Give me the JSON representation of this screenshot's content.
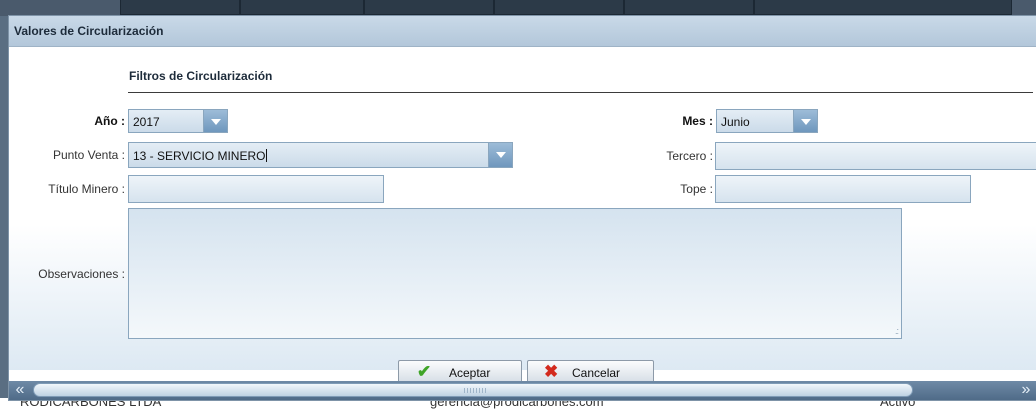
{
  "window": {
    "title": "Valores de Circularización"
  },
  "section": {
    "title": "Filtros de Circularización"
  },
  "form": {
    "anio": {
      "label": "Año :",
      "value": "2017"
    },
    "mes": {
      "label": "Mes :",
      "value": "Junio"
    },
    "punto_venta": {
      "label": "Punto Venta :",
      "value": "13 - SERVICIO MINERO"
    },
    "tercero": {
      "label": "Tercero :",
      "value": ""
    },
    "titulo_minero": {
      "label": "Título Minero :",
      "value": ""
    },
    "tope": {
      "label": "Tope :",
      "value": ""
    },
    "observaciones": {
      "label": "Observaciones :",
      "value": ""
    }
  },
  "buttons": {
    "aceptar": "Aceptar",
    "cancelar": "Cancelar"
  },
  "background_row": {
    "company": "RODICARBONES LTDA",
    "email": "gerencia@prodicarbones.com",
    "status": "Activo"
  },
  "colors": {
    "accept_icon": "#3fa427",
    "cancel_icon": "#d32a1d",
    "titlebar": "#c1d3e4"
  }
}
